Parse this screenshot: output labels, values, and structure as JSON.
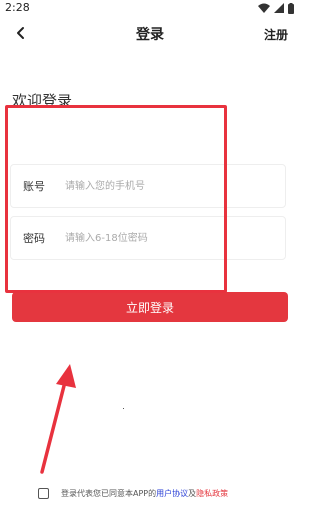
{
  "status_bar": {
    "time": "2:28"
  },
  "nav": {
    "title": "登录",
    "register_label": "注册"
  },
  "welcome_text": "欢迎登录",
  "form": {
    "account": {
      "label": "账号",
      "placeholder": "请输入您的手机号",
      "value": ""
    },
    "password": {
      "label": "密码",
      "placeholder": "请输入6-18位密码",
      "value": ""
    }
  },
  "login_button_label": "立即登录",
  "agreement": {
    "prefix": "登录代表您已同意本APP的",
    "user_agreement": "用户协议",
    "conjunction": "及",
    "privacy_policy": "隐私政策",
    "checked": false
  },
  "colors": {
    "accent": "#e4373f",
    "annotation": "#e8323e",
    "link_blue": "#2a3fd6"
  },
  "icons": {
    "back": "chevron-left-icon",
    "wifi": "wifi-icon",
    "signal": "signal-icon",
    "battery": "battery-icon"
  }
}
